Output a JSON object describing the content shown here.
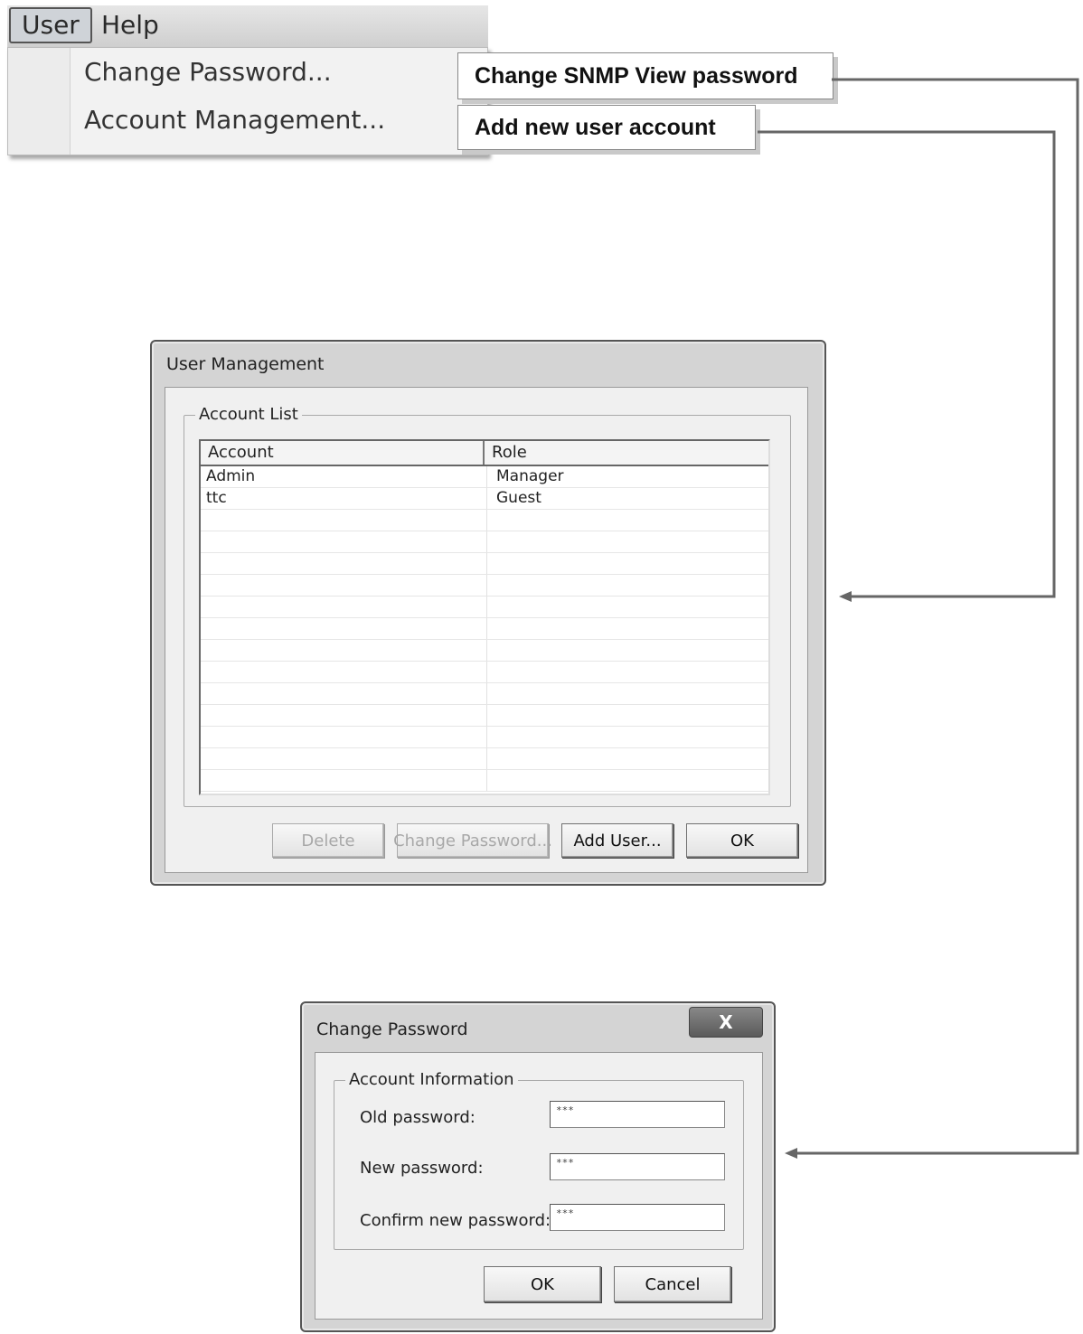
{
  "menu": {
    "top_items": [
      "User",
      "Help"
    ],
    "dropdown_items": [
      "Change Password...",
      "Account Management..."
    ]
  },
  "callouts": {
    "change_snmp": "Change SNMP View password",
    "add_user": "Add new user account"
  },
  "user_management": {
    "title": "User Management",
    "group_label": "Account List",
    "columns": [
      "Account",
      "Role"
    ],
    "rows": [
      {
        "account": "Admin",
        "role": "Manager"
      },
      {
        "account": "ttc",
        "role": "Guest"
      }
    ],
    "buttons": {
      "delete": "Delete",
      "change_password": "Change Password...",
      "add_user": "Add User...",
      "ok": "OK"
    }
  },
  "change_password": {
    "title": "Change Password",
    "close_glyph": "X",
    "group_label": "Account Information",
    "fields": {
      "old_label": "Old password:",
      "old_value": "***",
      "new_label": "New password:",
      "new_value": "***",
      "confirm_label": "Confirm new password:",
      "confirm_value": "***"
    },
    "buttons": {
      "ok": "OK",
      "cancel": "Cancel"
    }
  }
}
